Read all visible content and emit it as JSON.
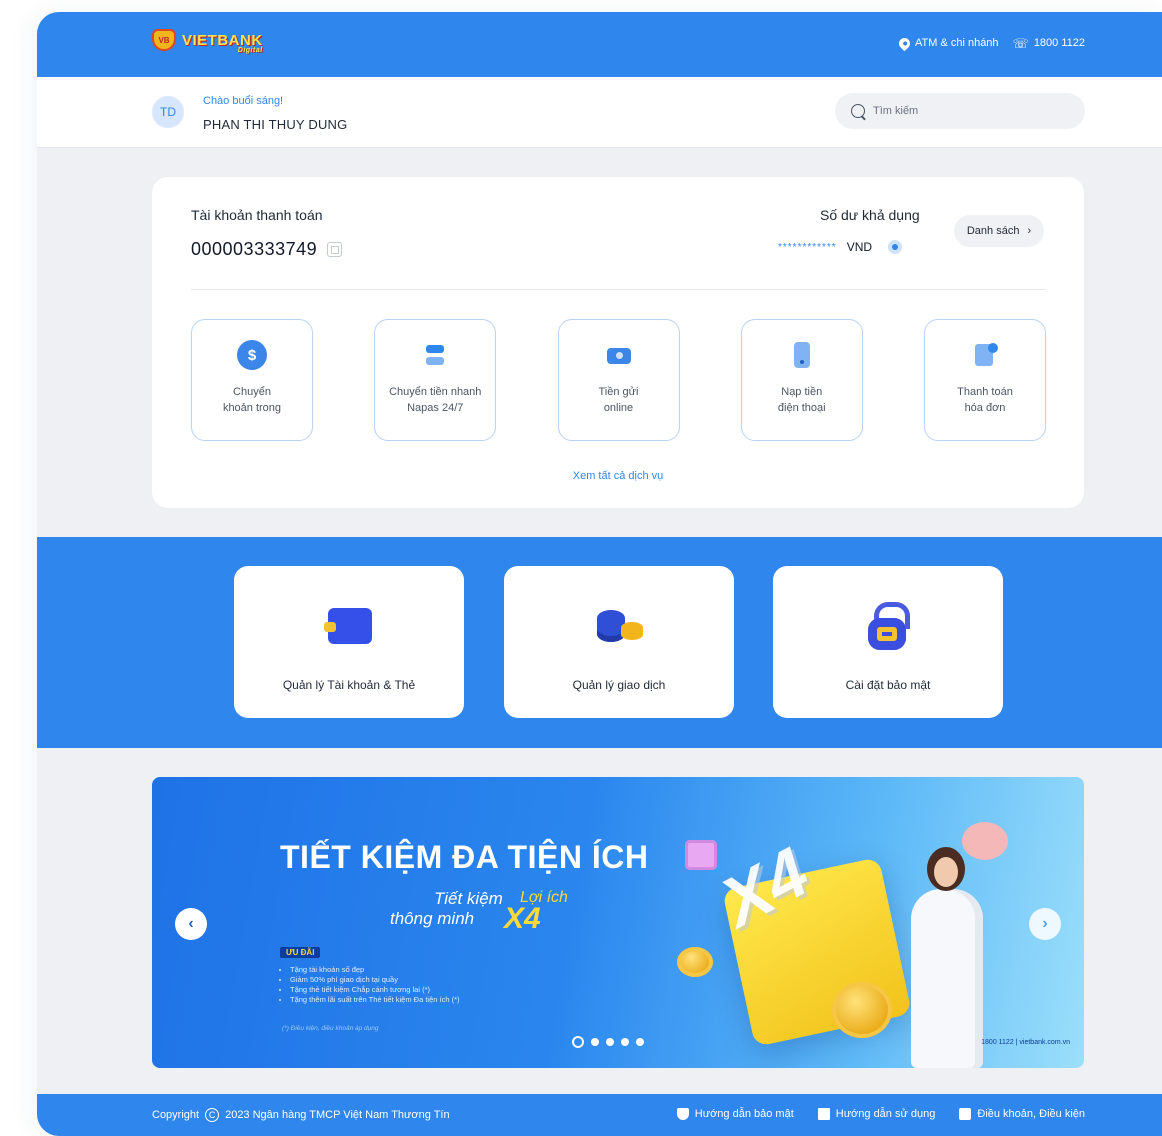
{
  "brand": {
    "name": "VIETBANK",
    "sub": "Digital",
    "badge": "VB"
  },
  "topbar": {
    "atm_label": "ATM & chi nhánh",
    "hotline": "1800 1122"
  },
  "user": {
    "initials": "TD",
    "greeting": "Chào buổi sáng!",
    "name": "PHAN THI THUY DUNG"
  },
  "search": {
    "placeholder": "Tìm kiếm"
  },
  "account": {
    "label": "Tài khoản thanh toán",
    "number": "000003333749",
    "balance_label": "Số dư khả dụng",
    "balance_masked": "************",
    "currency": "VND",
    "list_button": "Danh sách",
    "see_all": "Xem tất cả dịch vụ",
    "services": [
      {
        "line1": "Chuyển",
        "line2": "khoản trong",
        "icon": "dollar-transfer-icon"
      },
      {
        "line1": "Chuyển tiền nhanh",
        "line2": "Napas 24/7",
        "icon": "fast-transfer-icon"
      },
      {
        "line1": "Tiền gửi",
        "line2": "online",
        "icon": "deposit-icon"
      },
      {
        "line1": "Nạp tiền",
        "line2": "điện thoại",
        "icon": "phone-topup-icon"
      },
      {
        "line1": "Thanh toán",
        "line2": "hóa đơn",
        "icon": "bill-icon"
      }
    ]
  },
  "quick_actions": [
    {
      "label": "Quản lý Tài khoản & Thẻ",
      "icon": "wallet-icon"
    },
    {
      "label": "Quản lý giao dịch",
      "icon": "coins-icon"
    },
    {
      "label": "Cài đặt bảo mật",
      "icon": "lock-icon"
    }
  ],
  "banner": {
    "title": "TIẾT KIỆM ĐA TIỆN ÍCH",
    "sub_line1": "Tiết kiệm",
    "sub_line2": "thông minh",
    "highlight": "Lợi ích",
    "multiplier": "X4",
    "offer_tag": "ƯU ĐÃI",
    "offers": [
      "Tặng tài khoản số đẹp",
      "Giảm 50% phí giao dịch tại quầy",
      "Tặng thẻ tiết kiệm Chắp cánh tương lai (*)",
      "Tặng thêm lãi suất trên Thẻ tiết kiệm Đa tiện ích (*)"
    ],
    "note": "(*) Điều kiện, điều khoản áp dụng",
    "contact": "1800 1122 | vietbank.com.vn",
    "slide_count": 5,
    "active_slide": 1
  },
  "footer": {
    "copyright": "2023 Ngân hàng TMCP Việt Nam Thương Tín",
    "copyright_prefix": "Copyright",
    "links": [
      "Hướng dẫn bảo mật",
      "Hướng dẫn sử dụng",
      "Điều khoản, Điều kiện"
    ]
  },
  "colors": {
    "primary": "#2f86ec",
    "accent": "#ffd93b",
    "background": "#eef0f4"
  }
}
